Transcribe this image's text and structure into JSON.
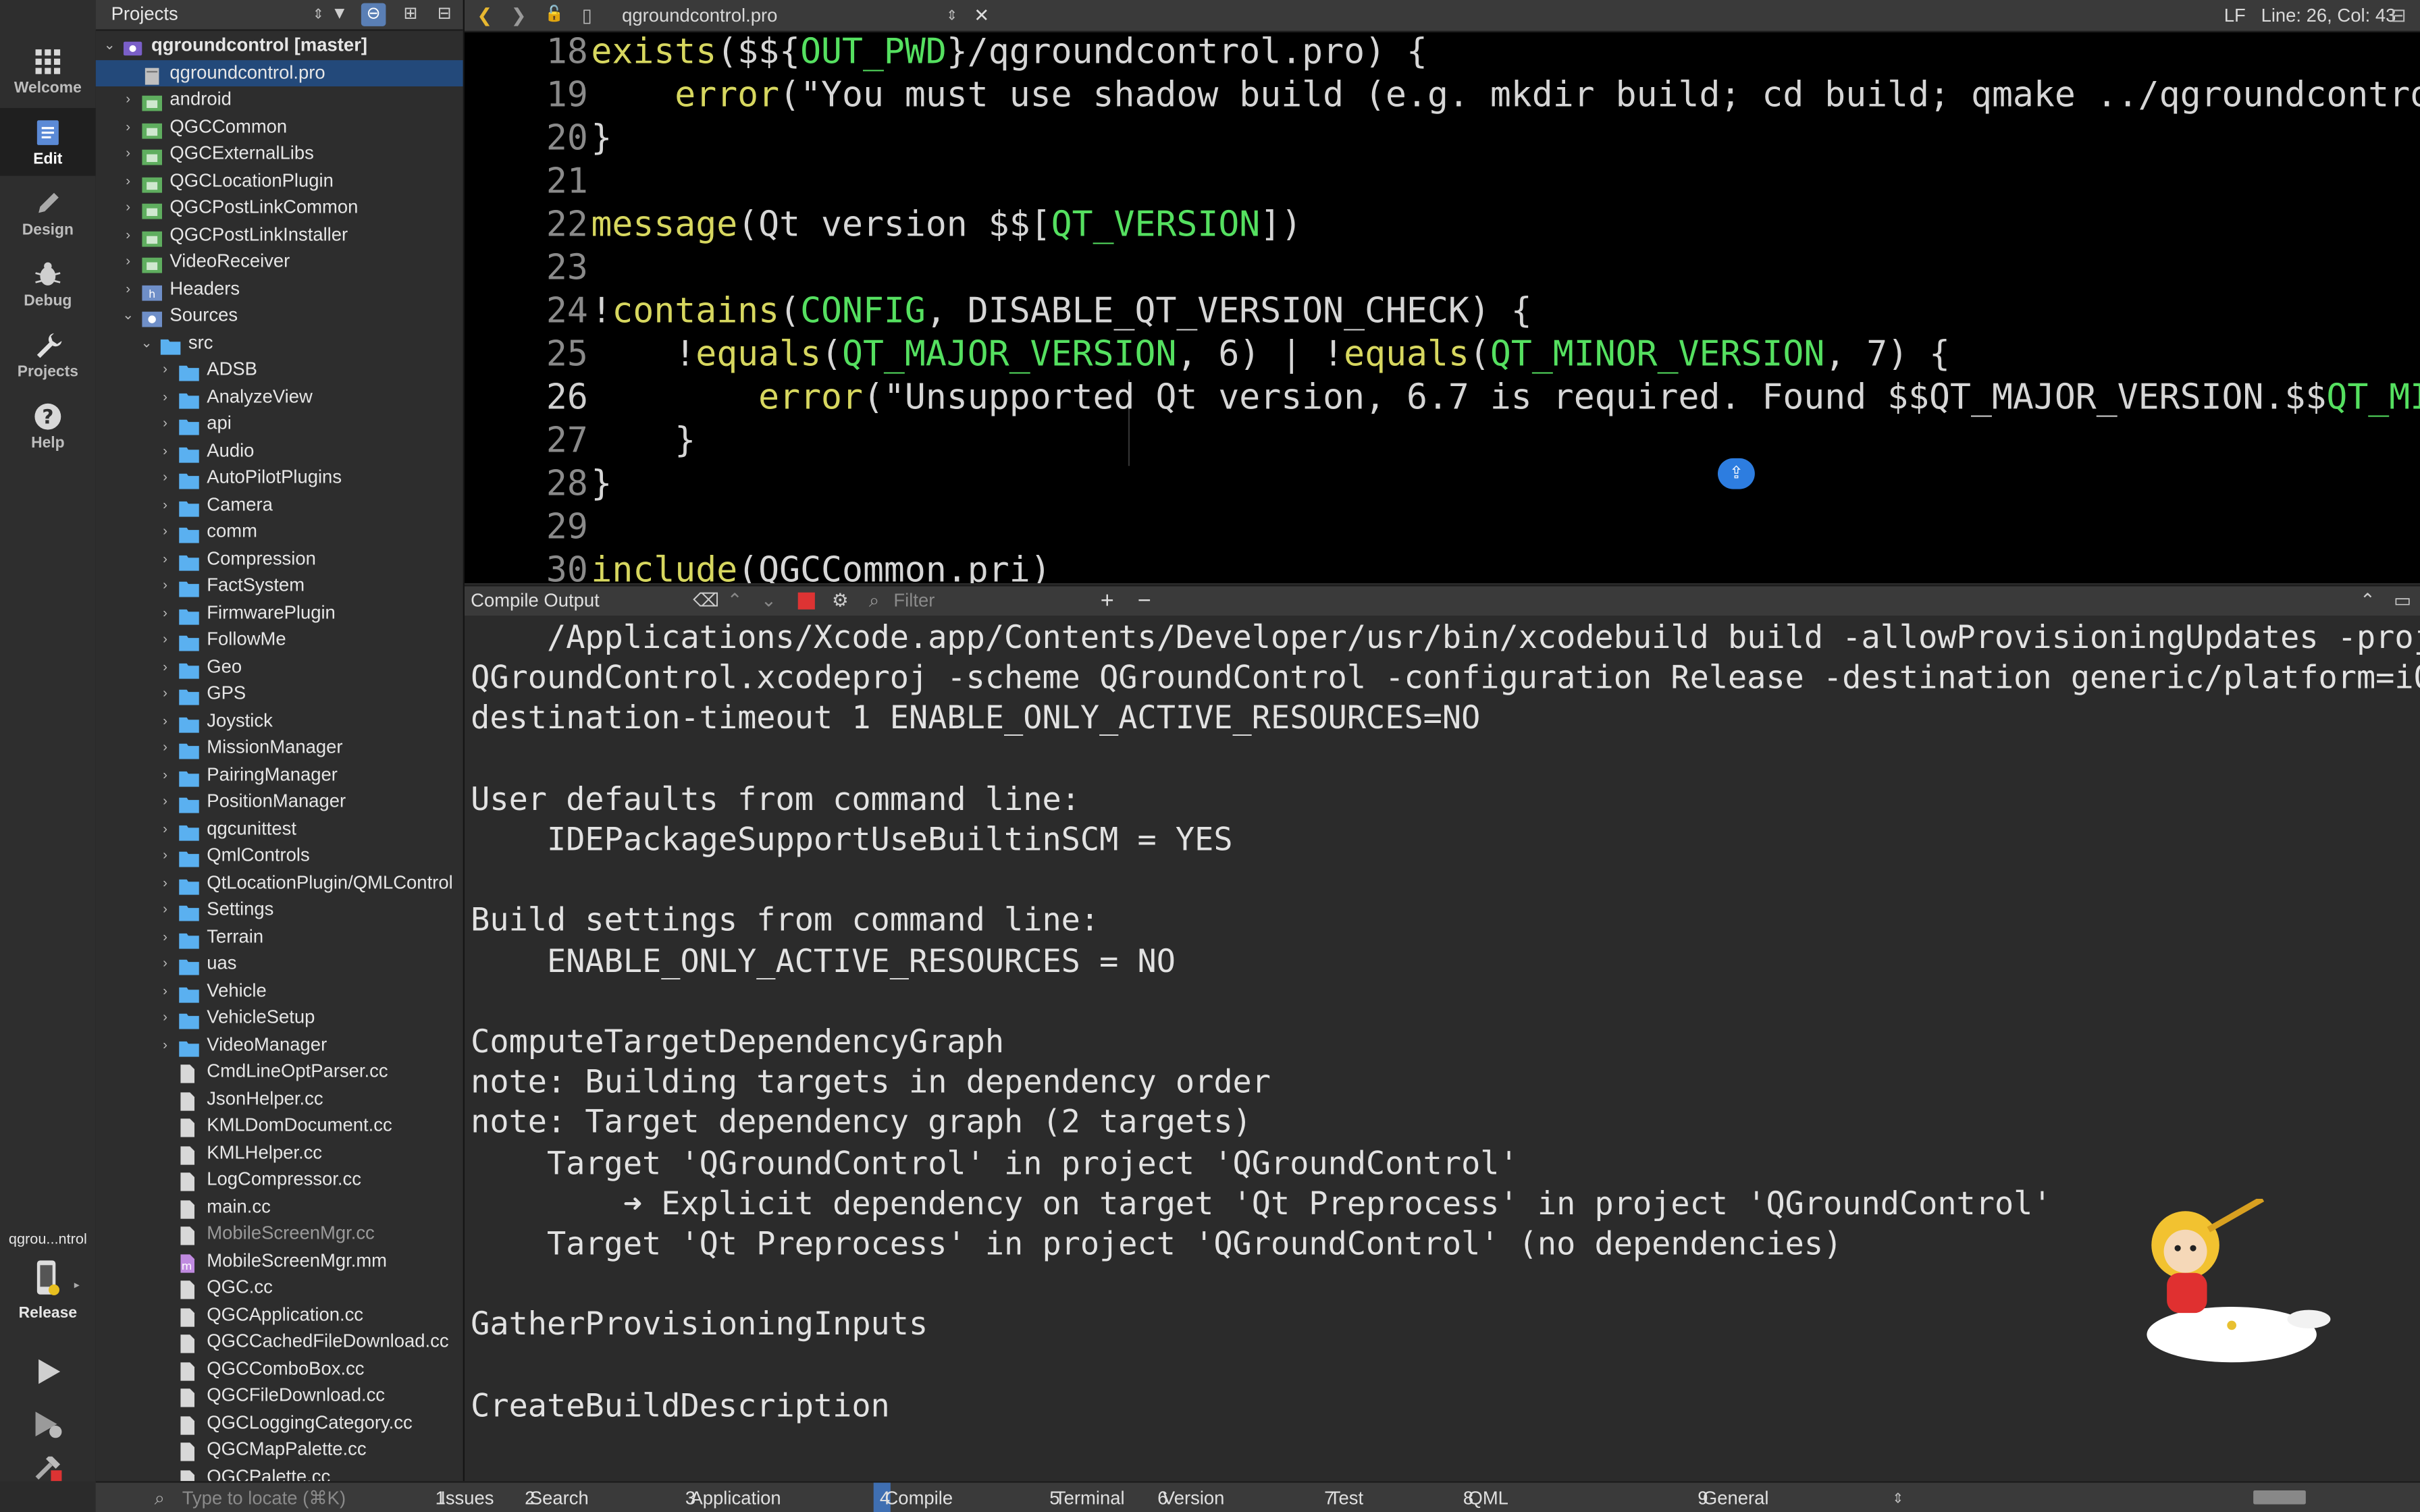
{
  "modebar": {
    "modes": [
      {
        "label": "Welcome",
        "icon": "grid-icon"
      },
      {
        "label": "Edit",
        "icon": "document-icon"
      },
      {
        "label": "Design",
        "icon": "pencil-icon"
      },
      {
        "label": "Debug",
        "icon": "bug-icon"
      },
      {
        "label": "Projects",
        "icon": "wrench-icon"
      },
      {
        "label": "Help",
        "icon": "question-icon"
      }
    ],
    "kit_name": "qgrou...ntrol",
    "build_config": "Release"
  },
  "projects": {
    "combo_label": "Projects",
    "tree": [
      {
        "label": "qgroundcontrol [master]",
        "bold": true
      },
      {
        "label": "qgroundcontrol.pro",
        "selected": true
      },
      {
        "label": "android"
      },
      {
        "label": "QGCCommon"
      },
      {
        "label": "QGCExternalLibs"
      },
      {
        "label": "QGCLocationPlugin"
      },
      {
        "label": "QGCPostLinkCommon"
      },
      {
        "label": "QGCPostLinkInstaller"
      },
      {
        "label": "VideoReceiver"
      },
      {
        "label": "Headers"
      },
      {
        "label": "Sources"
      },
      {
        "label": "src"
      },
      {
        "label": "ADSB"
      },
      {
        "label": "AnalyzeView"
      },
      {
        "label": "api"
      },
      {
        "label": "Audio"
      },
      {
        "label": "AutoPilotPlugins"
      },
      {
        "label": "Camera"
      },
      {
        "label": "comm"
      },
      {
        "label": "Compression"
      },
      {
        "label": "FactSystem"
      },
      {
        "label": "FirmwarePlugin"
      },
      {
        "label": "FollowMe"
      },
      {
        "label": "Geo"
      },
      {
        "label": "GPS"
      },
      {
        "label": "Joystick"
      },
      {
        "label": "MissionManager"
      },
      {
        "label": "PairingManager"
      },
      {
        "label": "PositionManager"
      },
      {
        "label": "qgcunittest"
      },
      {
        "label": "QmlControls"
      },
      {
        "label": "QtLocationPlugin/QMLControl"
      },
      {
        "label": "Settings"
      },
      {
        "label": "Terrain"
      },
      {
        "label": "uas"
      },
      {
        "label": "Vehicle"
      },
      {
        "label": "VehicleSetup"
      },
      {
        "label": "VideoManager"
      },
      {
        "label": "CmdLineOptParser.cc"
      },
      {
        "label": "JsonHelper.cc"
      },
      {
        "label": "KMLDomDocument.cc"
      },
      {
        "label": "KMLHelper.cc"
      },
      {
        "label": "LogCompressor.cc"
      },
      {
        "label": "main.cc"
      },
      {
        "label": "MobileScreenMgr.cc"
      },
      {
        "label": "MobileScreenMgr.mm"
      },
      {
        "label": "QGC.cc"
      },
      {
        "label": "QGCApplication.cc"
      },
      {
        "label": "QGCCachedFileDownload.cc"
      },
      {
        "label": "QGCComboBox.cc"
      },
      {
        "label": "QGCFileDownload.cc"
      },
      {
        "label": "QGCLoggingCategory.cc"
      },
      {
        "label": "QGCMapPalette.cc"
      },
      {
        "label": "QGCPalette.cc"
      }
    ]
  },
  "editor": {
    "file_name": "qgroundcontrol.pro",
    "line_ending": "LF",
    "position": "Line: 26, Col: 43",
    "line_numbers": [
      "18",
      "19",
      "20",
      "21",
      "22",
      "23",
      "24",
      "25",
      "26",
      "27",
      "28",
      "29",
      "30"
    ],
    "lines": {
      "l18a": "exists",
      "l18b": "($${",
      "l18c": "OUT_PWD",
      "l18d": "}/qgroundcontrol.pro) {",
      "l19a": "    ",
      "l19b": "error",
      "l19c": "(\"You must use shadow build (e.g. mkdir build; cd build; qmake ../qgroundcontrol.pro).",
      "l20": "}",
      "l21": "",
      "l22a": "message",
      "l22b": "(Qt version $$[",
      "l22c": "QT_VERSION",
      "l22d": "])",
      "l23": "",
      "l24a": "!",
      "l24b": "contains",
      "l24c": "(",
      "l24d": "CONFIG",
      "l24e": ", DISABLE_QT_VERSION_CHECK) {",
      "l25a": "    !",
      "l25b": "equals",
      "l25c": "(",
      "l25d": "QT_MAJOR_VERSION",
      "l25e": ", 6) | !",
      "l25f": "equals",
      "l25g": "(",
      "l25h": "QT_MINOR_VERSION",
      "l25i": ", 7) {",
      "l26a": "        ",
      "l26b": "error",
      "l26c": "(\"Unsupported Qt version, 6.7 is required. Found $$QT_MAJOR_VERSION.$$",
      "l26d": "QT_MINOR_VERSION",
      "l27": "    }",
      "l28": "}",
      "l29": "",
      "l30a": "include",
      "l30b": "(QGCCommon.pri)"
    }
  },
  "output": {
    "title": "Compile Output",
    "filter_placeholder": "Filter",
    "lines": [
      "    /Applications/Xcode.app/Contents/Developer/usr/bin/xcodebuild build -allowProvisioningUpdates -project",
      "QGroundControl.xcodeproj -scheme QGroundControl -configuration Release -destination generic/platform=iOS -",
      "destination-timeout 1 ENABLE_ONLY_ACTIVE_RESOURCES=NO",
      "",
      "User defaults from command line:",
      "    IDEPackageSupportUseBuiltinSCM = YES",
      "",
      "Build settings from command line:",
      "    ENABLE_ONLY_ACTIVE_RESOURCES = NO",
      "",
      "ComputeTargetDependencyGraph",
      "note: Building targets in dependency order",
      "note: Target dependency graph (2 targets)",
      "    Target 'QGroundControl' in project 'QGroundControl'",
      "        ➜ Explicit dependency on target 'Qt Preprocess' in project 'QGroundControl'",
      "    Target 'Qt Preprocess' in project 'QGroundControl' (no dependencies)",
      "",
      "GatherProvisioningInputs",
      "",
      "CreateBuildDescription"
    ]
  },
  "bottombar": {
    "locator_placeholder": "Type to locate (⌘K)",
    "tabs": [
      {
        "num": "1",
        "label": "Issues"
      },
      {
        "num": "2",
        "label": "Search Results"
      },
      {
        "num": "3",
        "label": "Application Output"
      },
      {
        "num": "4",
        "label": "Compile Output",
        "active": true
      },
      {
        "num": "5",
        "label": "Terminal"
      },
      {
        "num": "6",
        "label": "Version Control"
      },
      {
        "num": "7",
        "label": "Test Results"
      },
      {
        "num": "8",
        "label": "QML Debugger Console"
      },
      {
        "num": "9",
        "label": "General Messages"
      }
    ]
  }
}
